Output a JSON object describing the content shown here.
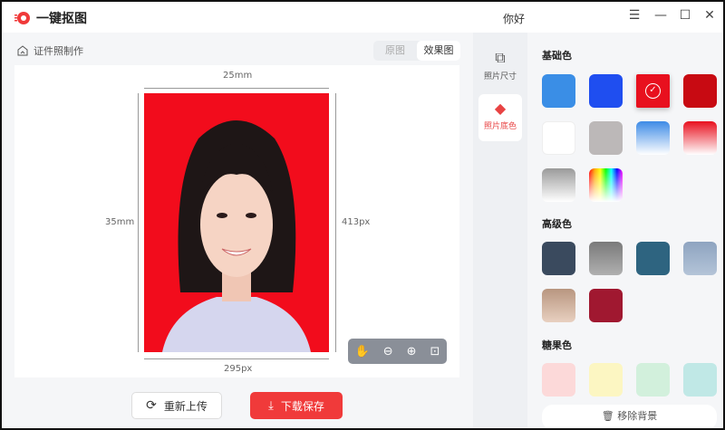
{
  "app": {
    "title": "一键抠图",
    "greeting": "你好"
  },
  "window_controls": {
    "menu": "☰",
    "minimize": "—",
    "maximize": "☐",
    "close": "✕"
  },
  "breadcrumb": "证件照制作",
  "view_toggle": {
    "original": "原图",
    "result": "效果图"
  },
  "dimensions": {
    "width_mm": "25mm",
    "height_mm": "35mm",
    "height_px": "413px",
    "width_px": "295px"
  },
  "buttons": {
    "reupload": "重新上传",
    "download": "下载保存",
    "remove_bg": "移除背景"
  },
  "nav": [
    {
      "label": "照片尺寸",
      "icon": "resize-icon"
    },
    {
      "label": "照片底色",
      "icon": "paint-bucket-icon"
    }
  ],
  "sections": {
    "basic": "基础色",
    "advanced": "高级色",
    "candy": "糖果色"
  },
  "colors": {
    "basic": [
      "#3a8ee6",
      "#1f4ef0",
      "#e8101e",
      "#c80a12",
      "#ffffff",
      "#bcb8b8",
      "linear-gradient(#3d8be6,#fff)",
      "linear-gradient(#e8101e,#fff)",
      "linear-gradient(#9a9a9a,#fff)",
      "rainbow"
    ],
    "advanced": [
      "#3a4a5e",
      "linear-gradient(#7a7a7a,#b0b0b0)",
      "#2e6480",
      "linear-gradient(#8ea4c0,#b4c4d8)",
      "linear-gradient(#b89680,#e8d0c0)",
      "#a01830"
    ],
    "candy": [
      "#fcd9d9",
      "#fcf6c2",
      "#d2f0dc",
      "#c0e8e6"
    ],
    "selected_index": 2,
    "accent": "#f03a3a"
  }
}
